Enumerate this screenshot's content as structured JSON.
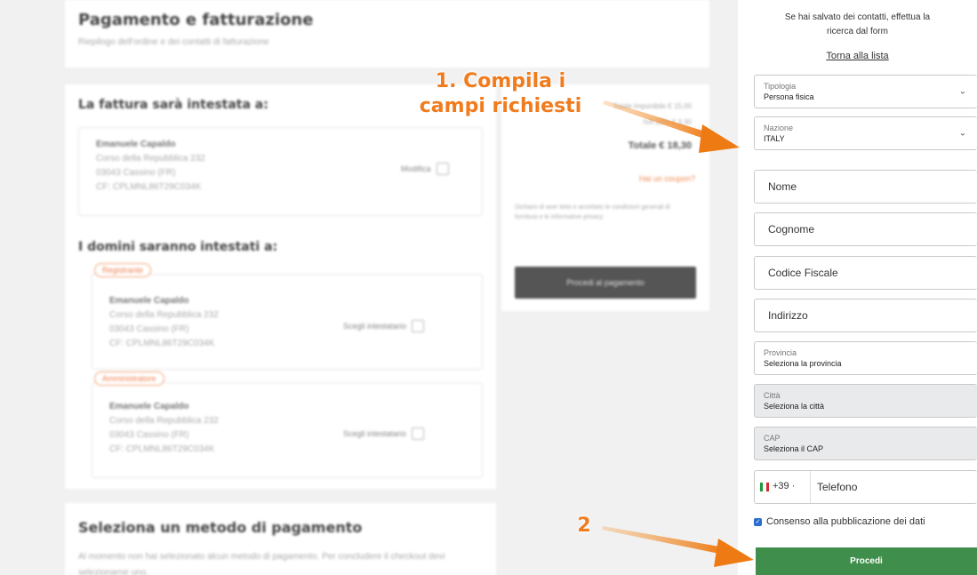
{
  "background": {
    "billing_card": {
      "title": "Pagamento e fatturazione",
      "subtitle": "Riepilogo dell'ordine e dei contatti di fatturazione"
    },
    "invoice": {
      "heading": "La fattura sarà intestata a:",
      "name": "Emanuele Capaldo",
      "street": "Corso della Repubblica 232",
      "city": "03043 Cassino (FR)",
      "cf": "CF: CPLMNL86T29C034K",
      "edit_label": "Modifica"
    },
    "domains": {
      "heading": "I domini saranno intestati a:",
      "contacts": [
        {
          "role": "Registrante",
          "name": "Emanuele Capaldo",
          "street": "Corso della Repubblica 232",
          "city": "03043 Cassino (FR)",
          "cf": "CF: CPLMNL86T29C034K",
          "action": "Scegli intestatario"
        },
        {
          "role": "Amministratore",
          "name": "Emanuele Capaldo",
          "street": "Corso della Repubblica 232",
          "city": "03043 Cassino (FR)",
          "cf": "CF: CPLMNL86T29C034K",
          "action": "Scegli intestatario"
        }
      ]
    },
    "summary": {
      "subtotal": "Totale imponibile € 15,00",
      "vat": "IVA 22% € 3,30",
      "total": "Totale € 18,30",
      "coupon": "Hai un coupon?",
      "terms": "Dichiaro di aver letto e accettato le condizioni generali di fornitura e le informative privacy",
      "pay_button": "Procedi al pagamento"
    },
    "payment": {
      "heading": "Seleziona un metodo di pagamento",
      "text": "Al momento non hai selezionato alcun metodo di pagamento. Per concludere il checkout devi selezionarne uno."
    }
  },
  "form": {
    "intro": "Se hai salvato dei contatti, effettua la ricerca dal form",
    "back_link": "Torna alla lista",
    "tipologia": {
      "label": "Tipologia",
      "value": "Persona fisica"
    },
    "nazione": {
      "label": "Nazione",
      "value": "ITALY"
    },
    "nome_placeholder": "Nome",
    "cognome_placeholder": "Cognome",
    "cf_placeholder": "Codice Fiscale",
    "indirizzo_placeholder": "Indirizzo",
    "provincia": {
      "label": "Provincia",
      "value": "Seleziona la provincia"
    },
    "citta": {
      "label": "Città",
      "value": "Seleziona la città"
    },
    "cap": {
      "label": "CAP",
      "value": "Seleziona il CAP"
    },
    "phone": {
      "prefix": "+39 ·",
      "placeholder": "Telefono"
    },
    "consent": "Consenso alla pubblicazione dei dati",
    "submit": "Procedi"
  },
  "annotations": {
    "step1_line1": "1. Compila i",
    "step1_line2": "campi richiesti",
    "step2": "2"
  },
  "colors": {
    "accent_orange": "#f07c1e",
    "submit_green": "#3f8e4b",
    "checkbox_blue": "#2a6dcf"
  },
  "icons": [
    "chevron-down-icon",
    "italy-flag-icon",
    "checkbox-checked-icon",
    "edit-icon",
    "orange-arrow-annotation"
  ]
}
